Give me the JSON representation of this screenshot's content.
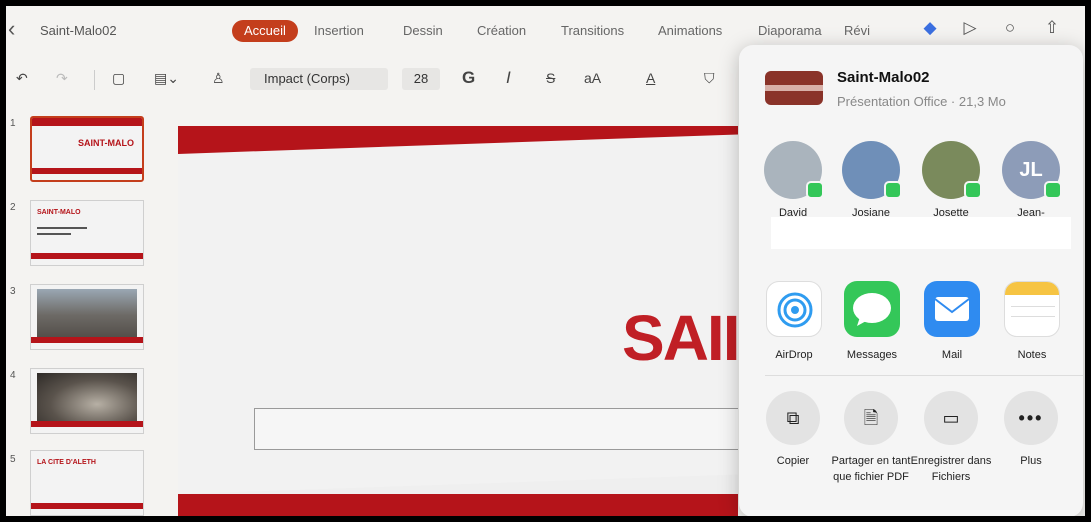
{
  "window": {
    "doc_name": "Saint-Malo02"
  },
  "tabs": [
    {
      "label": "Accueil",
      "active": true
    },
    {
      "label": "Insertion"
    },
    {
      "label": "Dessin"
    },
    {
      "label": "Création"
    },
    {
      "label": "Transitions"
    },
    {
      "label": "Animations"
    },
    {
      "label": "Diaporama"
    },
    {
      "label": "Révi"
    }
  ],
  "ribbon": {
    "font_name": "Impact (Corps)",
    "font_size": "28",
    "bold": "G",
    "italic": "I",
    "strike": "S",
    "case": "aA"
  },
  "slides": [
    {
      "number": "1",
      "title": "SAINT-MALO"
    },
    {
      "number": "2",
      "title": "SAINT-MALO"
    },
    {
      "number": "3",
      "title": ""
    },
    {
      "number": "4",
      "title": ""
    },
    {
      "number": "5",
      "title": "LA CITE D'ALETH"
    }
  ],
  "slide": {
    "title": "SAII"
  },
  "share": {
    "doc_title": "Saint-Malo02",
    "doc_subtitle": "Présentation Office · 21,3 Mo",
    "people": [
      {
        "name": "David"
      },
      {
        "name": "Josiane"
      },
      {
        "name": "Josette"
      },
      {
        "name": "Jean-",
        "initials": "JL"
      }
    ],
    "apps": [
      {
        "label": "AirDrop"
      },
      {
        "label": "Messages"
      },
      {
        "label": "Mail"
      },
      {
        "label": "Notes"
      }
    ],
    "actions": [
      {
        "label": "Copier"
      },
      {
        "label": "Partager en tant que fichier PDF"
      },
      {
        "label": "Enregistrer dans Fichiers"
      },
      {
        "label": "Plus"
      }
    ]
  },
  "colors": {
    "accent": "#c43e1c",
    "slide_red": "#b5141a"
  }
}
